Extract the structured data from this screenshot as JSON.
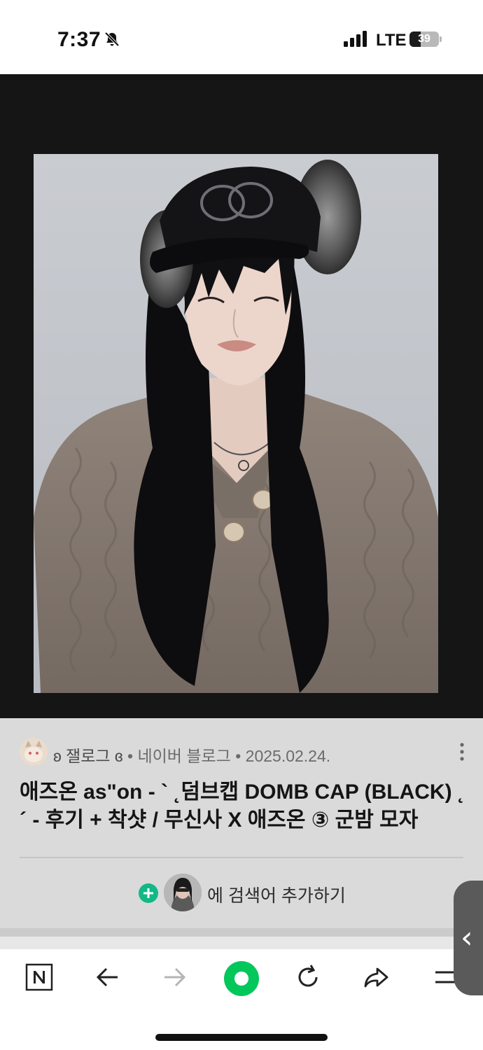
{
  "status_bar": {
    "time": "7:37",
    "network": "LTE",
    "battery_level": 39,
    "battery_text": "39"
  },
  "post": {
    "author": "ʚ 잴로그 ɞ",
    "separator": "•",
    "source": "네이버 블로그",
    "date": "2025.02.24.",
    "title": "애즈온 as\"on - ` ˛덤브캡 DOMB CAP (BLACK) ˛´ - 후기 + 착샷 / 무신사 X 애즈온 ③ 군밤 모자"
  },
  "keyword_add": {
    "label": "에 검색어 추가하기"
  },
  "side_handle": {
    "glyph": "‹"
  },
  "toolbar": {
    "items": [
      "naver-home",
      "back",
      "forward",
      "green-dot",
      "reload",
      "share",
      "menu"
    ]
  },
  "colors": {
    "accent_green": "#03c75a",
    "plus_green": "#12b886",
    "frame_bg": "#151515",
    "info_bg": "#dadada"
  }
}
